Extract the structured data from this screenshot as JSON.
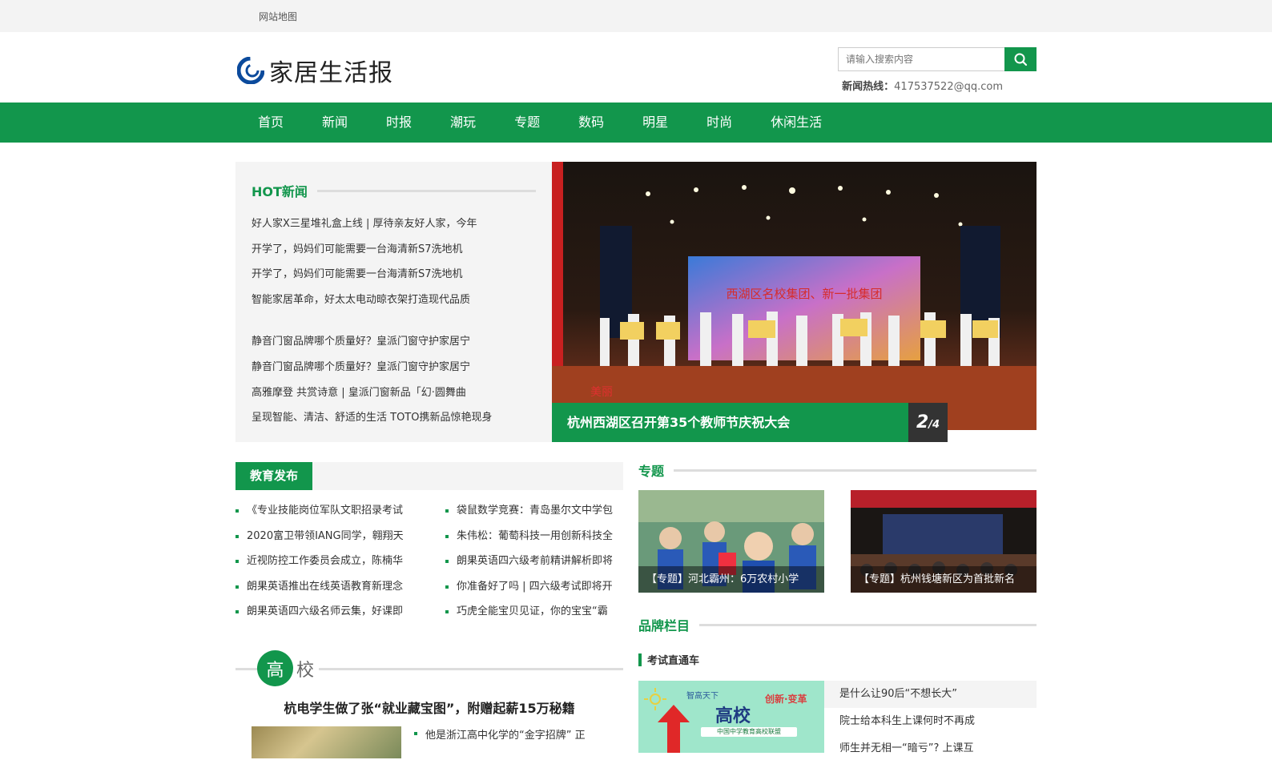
{
  "topbar": {
    "sitemap": "网站地图"
  },
  "header": {
    "site_name": "家居生活报",
    "search_placeholder": "请输入搜索内容",
    "hotline_label": "新闻热线：",
    "hotline_value": "417537522@qq.com"
  },
  "nav": [
    "首页",
    "新闻",
    "时报",
    "潮玩",
    "专题",
    "数码",
    "明星",
    "时尚",
    "休闲生活"
  ],
  "hot": {
    "title": "HOT新闻",
    "group1": [
      "好人家X三星堆礼盒上线 | 厚待亲友好人家，今年",
      "开学了，妈妈们可能需要一台海清新S7洗地机",
      "开学了，妈妈们可能需要一台海清新S7洗地机",
      "智能家居革命，好太太电动晾衣架打造现代品质"
    ],
    "group2": [
      "静音门窗品牌哪个质量好？皇派门窗守护家居宁",
      "静音门窗品牌哪个质量好？皇派门窗守护家居宁",
      "高雅摩登 共赏诗意 | 皇派门窗新品「幻·圆舞曲",
      "呈现智能、清洁、舒适的生活 TOTO携新品惊艳现身"
    ]
  },
  "slider": {
    "caption": "杭州西湖区召开第35个教师节庆祝大会",
    "current": "2",
    "total": "/4",
    "screen_text": "西湖区名校集团、新一批集团",
    "corner_text": "美丽"
  },
  "edu": {
    "title": "教育发布",
    "left": [
      "《专业技能岗位军队文职招录考试",
      "2020富卫带领IANG同学，翱翔天",
      "近视防控工作委员会成立，陈楠华",
      "朗果英语推出在线英语教育新理念",
      "朗果英语四六级名师云集，好课即"
    ],
    "right": [
      "袋鼠数学竞赛：青岛墨尔文中学包",
      "朱伟松：葡萄科技一用创新科技全",
      "朗果英语四六级考前精讲解析即将",
      "你准备好了吗 | 四六级考试即将开",
      "巧虎全能宝贝见证，你的宝宝“霸"
    ]
  },
  "gaoxiao": {
    "badge_char": "高",
    "badge_rest": "校",
    "story": "杭电学生做了张“就业藏宝图”，附赠起薪15万秘籍",
    "item": "他是浙江高中化学的“金字招牌” 正"
  },
  "topic": {
    "title": "专题",
    "cards": [
      "【专题】河北霸州：6万农村小学",
      "【专题】杭州钱塘新区为首批新名"
    ]
  },
  "brand": {
    "title": "品牌栏目",
    "sub": "考试直通车",
    "ad": {
      "small": "智高天下",
      "big": "高校",
      "tag": "创新·变革",
      "strip": "中国中学教育高校联盟"
    },
    "news": [
      "是什么让90后“不想长大”",
      "院士给本科生上课何时不再成",
      "师生并无相一“暗亏”? 上课互"
    ]
  },
  "colors": {
    "brand_green": "#12964c"
  }
}
